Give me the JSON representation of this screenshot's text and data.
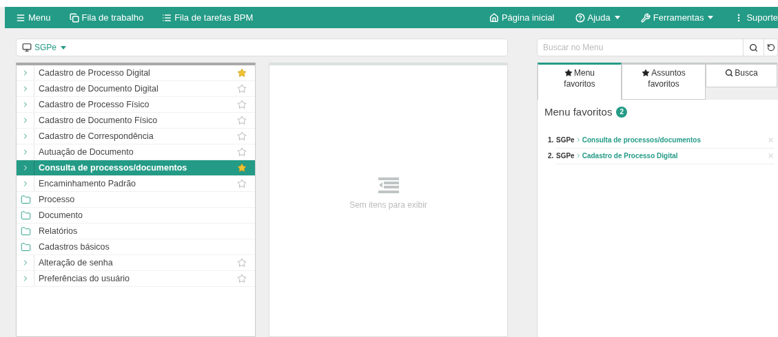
{
  "nav": {
    "left": [
      {
        "label": "Menu",
        "dropdown": false
      },
      {
        "label": "Fila de trabalho",
        "dropdown": false
      },
      {
        "label": "Fila de tarefas BPM",
        "dropdown": false
      }
    ],
    "right": [
      {
        "label": "Página inicial",
        "dropdown": false
      },
      {
        "label": "Ajuda",
        "dropdown": true
      },
      {
        "label": "Ferramentas",
        "dropdown": true
      },
      {
        "label": "Suporte",
        "dropdown": false
      }
    ]
  },
  "system_selector": {
    "label": "SGPe",
    "dropdown": true
  },
  "menu_tree": [
    {
      "kind": "link",
      "label": "Cadastro de Processo Digital",
      "starred": true,
      "selected": false
    },
    {
      "kind": "link",
      "label": "Cadastro de Documento Digital",
      "starred": false,
      "selected": false
    },
    {
      "kind": "link",
      "label": "Cadastro de Processo Físico",
      "starred": false,
      "selected": false
    },
    {
      "kind": "link",
      "label": "Cadastro de Documento Físico",
      "starred": false,
      "selected": false
    },
    {
      "kind": "link",
      "label": "Cadastro de Correspondência",
      "starred": false,
      "selected": false
    },
    {
      "kind": "link",
      "label": "Autuação de Documento",
      "starred": false,
      "selected": false
    },
    {
      "kind": "link",
      "label": "Consulta de processos/documentos",
      "starred": true,
      "selected": true
    },
    {
      "kind": "link",
      "label": "Encaminhamento Padrão",
      "starred": false,
      "selected": false
    },
    {
      "kind": "folder",
      "label": "Processo",
      "selected": false
    },
    {
      "kind": "folder",
      "label": "Documento",
      "selected": false
    },
    {
      "kind": "folder",
      "label": "Relatórios",
      "selected": false
    },
    {
      "kind": "folder",
      "label": "Cadastros básicos",
      "selected": false
    },
    {
      "kind": "link",
      "label": "Alteração de senha",
      "starred": false,
      "selected": false
    },
    {
      "kind": "link",
      "label": "Preferências do usuário",
      "starred": false,
      "selected": false
    }
  ],
  "empty_panel": {
    "message": "Sem itens para exibir"
  },
  "search": {
    "placeholder": "Buscar no Menu"
  },
  "tabs": [
    {
      "label": "Menu favoritos",
      "selected": true
    },
    {
      "label": "Assuntos favoritos",
      "selected": false
    },
    {
      "label": "Busca",
      "selected": false
    }
  ],
  "favorites": {
    "title": "Menu favoritos",
    "count": "2",
    "items": [
      {
        "number": "1.",
        "system": "SGPe",
        "name": "Consulta de processos/documentos"
      },
      {
        "number": "2.",
        "system": "SGPe",
        "name": "Cadastro de Processo Digital"
      }
    ]
  }
}
